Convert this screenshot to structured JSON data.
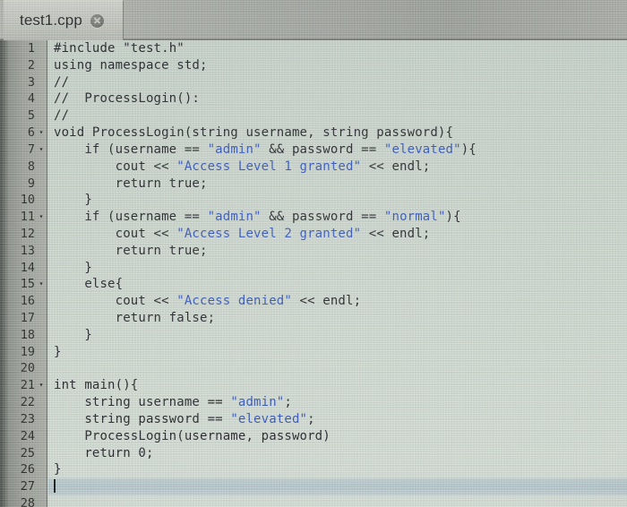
{
  "window": {
    "kind": "code-editor",
    "colors": {
      "editor_background": "#cdd8cf",
      "gutter_background": "#a2a69f",
      "tabbar_background": "#a9ada7",
      "string_literal": "#3355bb",
      "code_foreground": "#24262b",
      "active_line_highlight": "#a0b8cb"
    }
  },
  "tabbar": {
    "tabs": [
      {
        "label": "test1.cpp",
        "active": true,
        "close_icon": "close-circle-icon"
      }
    ]
  },
  "editor": {
    "language": "cpp",
    "cursor_line": 27,
    "first_visible_line": 1,
    "last_visible_line": 28,
    "fold_marker_glyph": "▾",
    "fold_lines": [
      6,
      7,
      11,
      15,
      21
    ],
    "lines": [
      {
        "n": "1",
        "fold": false,
        "tokens": [
          {
            "t": "#include ",
            "k": "code"
          },
          {
            "t": "\"test.h\"",
            "k": "code"
          }
        ]
      },
      {
        "n": "2",
        "fold": false,
        "tokens": [
          {
            "t": "using namespace std;",
            "k": "code"
          }
        ]
      },
      {
        "n": "3",
        "fold": false,
        "tokens": [
          {
            "t": "//",
            "k": "code"
          }
        ]
      },
      {
        "n": "4",
        "fold": false,
        "tokens": [
          {
            "t": "//  ProcessLogin():",
            "k": "code"
          }
        ]
      },
      {
        "n": "5",
        "fold": false,
        "tokens": [
          {
            "t": "//",
            "k": "code"
          }
        ]
      },
      {
        "n": "6",
        "fold": true,
        "tokens": [
          {
            "t": "void ProcessLogin(string username, string password){",
            "k": "code"
          }
        ]
      },
      {
        "n": "7",
        "fold": true,
        "tokens": [
          {
            "t": "    if (username == ",
            "k": "code"
          },
          {
            "t": "\"admin\"",
            "k": "str"
          },
          {
            "t": " && password == ",
            "k": "code"
          },
          {
            "t": "\"elevated\"",
            "k": "str"
          },
          {
            "t": "){",
            "k": "code"
          }
        ]
      },
      {
        "n": "8",
        "fold": false,
        "tokens": [
          {
            "t": "        cout << ",
            "k": "code"
          },
          {
            "t": "\"Access Level 1 granted\"",
            "k": "str"
          },
          {
            "t": " << endl;",
            "k": "code"
          }
        ]
      },
      {
        "n": "9",
        "fold": false,
        "tokens": [
          {
            "t": "        return true;",
            "k": "code"
          }
        ]
      },
      {
        "n": "10",
        "fold": false,
        "tokens": [
          {
            "t": "    }",
            "k": "code"
          }
        ]
      },
      {
        "n": "11",
        "fold": true,
        "tokens": [
          {
            "t": "    if (username == ",
            "k": "code"
          },
          {
            "t": "\"admin\"",
            "k": "str"
          },
          {
            "t": " && password == ",
            "k": "code"
          },
          {
            "t": "\"normal\"",
            "k": "str"
          },
          {
            "t": "){",
            "k": "code"
          }
        ]
      },
      {
        "n": "12",
        "fold": false,
        "tokens": [
          {
            "t": "        cout << ",
            "k": "code"
          },
          {
            "t": "\"Access Level 2 granted\"",
            "k": "str"
          },
          {
            "t": " << endl;",
            "k": "code"
          }
        ]
      },
      {
        "n": "13",
        "fold": false,
        "tokens": [
          {
            "t": "        return true;",
            "k": "code"
          }
        ]
      },
      {
        "n": "14",
        "fold": false,
        "tokens": [
          {
            "t": "    }",
            "k": "code"
          }
        ]
      },
      {
        "n": "15",
        "fold": true,
        "tokens": [
          {
            "t": "    else{",
            "k": "code"
          }
        ]
      },
      {
        "n": "16",
        "fold": false,
        "tokens": [
          {
            "t": "        cout << ",
            "k": "code"
          },
          {
            "t": "\"Access denied\"",
            "k": "str"
          },
          {
            "t": " << endl;",
            "k": "code"
          }
        ]
      },
      {
        "n": "17",
        "fold": false,
        "tokens": [
          {
            "t": "        return false;",
            "k": "code"
          }
        ]
      },
      {
        "n": "18",
        "fold": false,
        "tokens": [
          {
            "t": "    }",
            "k": "code"
          }
        ]
      },
      {
        "n": "19",
        "fold": false,
        "tokens": [
          {
            "t": "}",
            "k": "code"
          }
        ]
      },
      {
        "n": "20",
        "fold": false,
        "tokens": [
          {
            "t": "",
            "k": "code"
          }
        ]
      },
      {
        "n": "21",
        "fold": true,
        "tokens": [
          {
            "t": "int main(){",
            "k": "code"
          }
        ]
      },
      {
        "n": "22",
        "fold": false,
        "tokens": [
          {
            "t": "    string username == ",
            "k": "code"
          },
          {
            "t": "\"admin\"",
            "k": "str"
          },
          {
            "t": ";",
            "k": "code"
          }
        ]
      },
      {
        "n": "23",
        "fold": false,
        "tokens": [
          {
            "t": "    string password == ",
            "k": "code"
          },
          {
            "t": "\"elevated\"",
            "k": "str"
          },
          {
            "t": ";",
            "k": "code"
          }
        ]
      },
      {
        "n": "24",
        "fold": false,
        "tokens": [
          {
            "t": "    ProcessLogin(username, password)",
            "k": "code"
          }
        ]
      },
      {
        "n": "25",
        "fold": false,
        "tokens": [
          {
            "t": "    return 0;",
            "k": "code"
          }
        ]
      },
      {
        "n": "26",
        "fold": false,
        "tokens": [
          {
            "t": "}",
            "k": "code"
          }
        ]
      },
      {
        "n": "27",
        "fold": false,
        "caret": true,
        "tokens": [
          {
            "t": "",
            "k": "code"
          }
        ]
      },
      {
        "n": "28",
        "fold": false,
        "tokens": [
          {
            "t": "",
            "k": "code"
          }
        ]
      }
    ]
  }
}
